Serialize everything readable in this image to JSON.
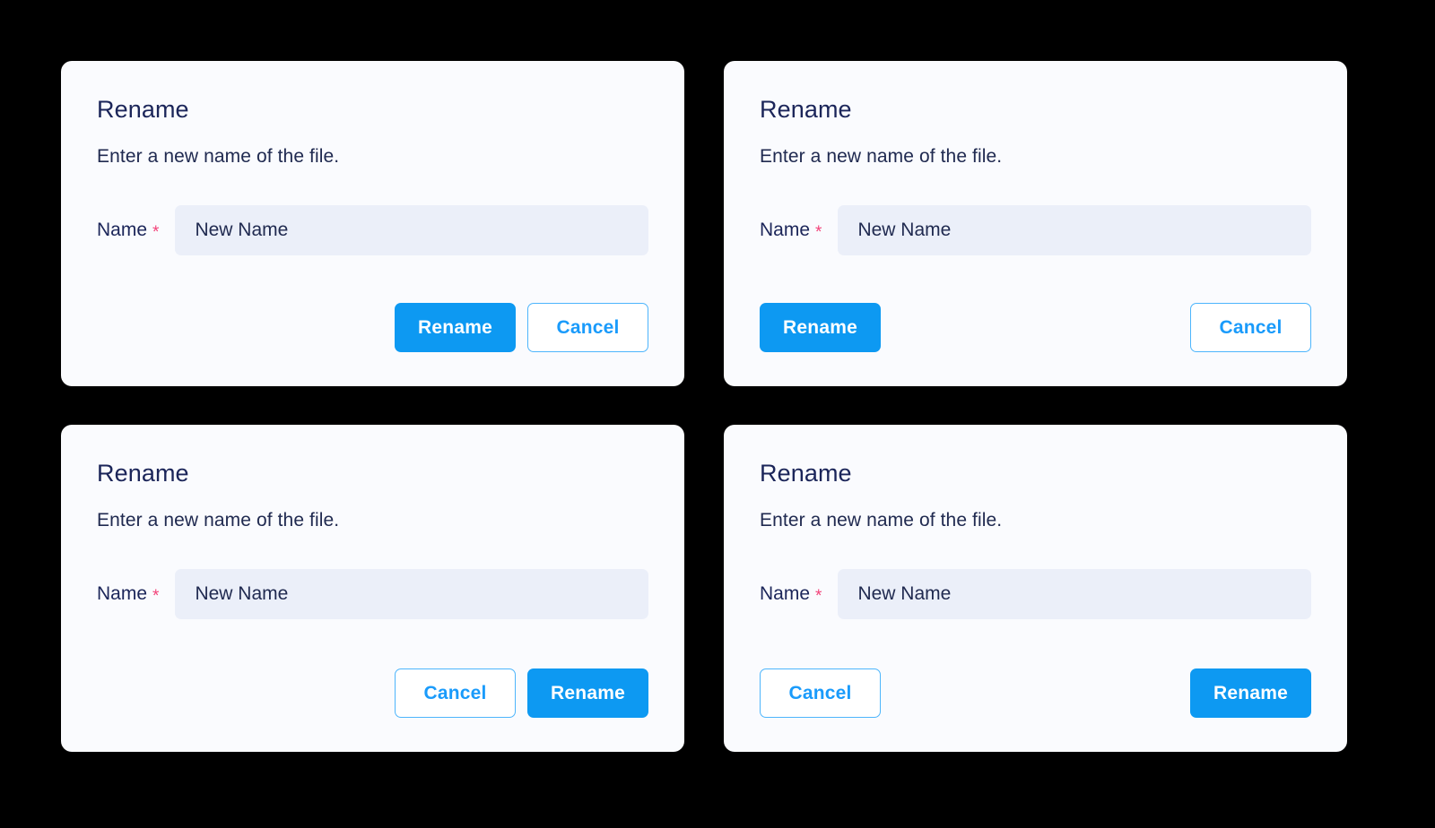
{
  "theme": {
    "page_background": "#000000",
    "card_background": "#FAFBFE",
    "title_color": "#1B2559",
    "text_color": "#202A50",
    "input_background": "#EBEFF9",
    "required_color": "#F2437A",
    "primary_button_background": "#0D99F2",
    "primary_button_text": "#FFFFFF",
    "secondary_button_text": "#1A9BFB",
    "secondary_button_border": "#4DB5FC"
  },
  "dialogs": [
    {
      "id": "rename-dialog-primary-first-right-aligned",
      "title": "Rename",
      "description": "Enter a new name of the file.",
      "field": {
        "label": "Name",
        "required_marker": "*",
        "placeholder": "New Name",
        "value": ""
      },
      "actions": {
        "layout": "align-end",
        "buttons": [
          {
            "label": "Rename",
            "variant": "primary"
          },
          {
            "label": "Cancel",
            "variant": "secondary"
          }
        ]
      }
    },
    {
      "id": "rename-dialog-primary-first-space-between",
      "title": "Rename",
      "description": "Enter a new name of the file.",
      "field": {
        "label": "Name",
        "required_marker": "*",
        "placeholder": "New Name",
        "value": ""
      },
      "actions": {
        "layout": "space-between",
        "buttons": [
          {
            "label": "Rename",
            "variant": "primary"
          },
          {
            "label": "Cancel",
            "variant": "secondary"
          }
        ]
      }
    },
    {
      "id": "rename-dialog-cancel-first-right-aligned",
      "title": "Rename",
      "description": "Enter a new name of the file.",
      "field": {
        "label": "Name",
        "required_marker": "*",
        "placeholder": "New Name",
        "value": ""
      },
      "actions": {
        "layout": "align-end",
        "buttons": [
          {
            "label": "Cancel",
            "variant": "secondary"
          },
          {
            "label": "Rename",
            "variant": "primary"
          }
        ]
      }
    },
    {
      "id": "rename-dialog-cancel-first-space-between",
      "title": "Rename",
      "description": "Enter a new name of the file.",
      "field": {
        "label": "Name",
        "required_marker": "*",
        "placeholder": "New Name",
        "value": ""
      },
      "actions": {
        "layout": "space-between",
        "buttons": [
          {
            "label": "Cancel",
            "variant": "secondary"
          },
          {
            "label": "Rename",
            "variant": "primary"
          }
        ]
      }
    }
  ]
}
